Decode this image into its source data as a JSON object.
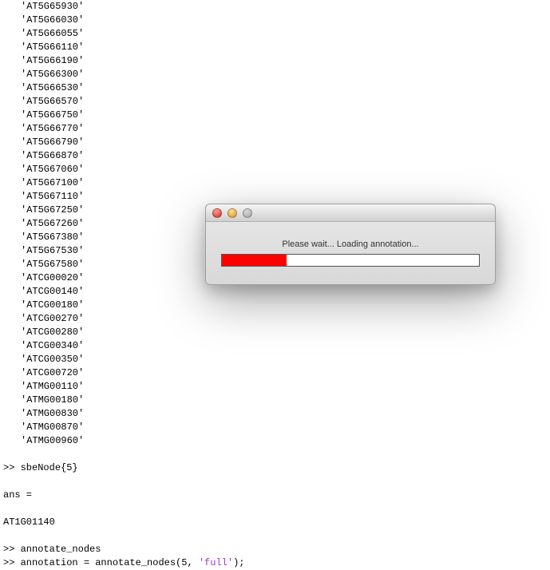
{
  "terminal": {
    "genes": [
      "AT5G65930",
      "AT5G66030",
      "AT5G66055",
      "AT5G66110",
      "AT5G66190",
      "AT5G66300",
      "AT5G66530",
      "AT5G66570",
      "AT5G66750",
      "AT5G66770",
      "AT5G66790",
      "AT5G66870",
      "AT5G67060",
      "AT5G67100",
      "AT5G67110",
      "AT5G67250",
      "AT5G67260",
      "AT5G67380",
      "AT5G67530",
      "AT5G67580",
      "ATCG00020",
      "ATCG00140",
      "ATCG00180",
      "ATCG00270",
      "ATCG00280",
      "ATCG00340",
      "ATCG00350",
      "ATCG00720",
      "ATMG00110",
      "ATMG00180",
      "ATMG00830",
      "ATMG00870",
      "ATMG00960"
    ],
    "cmd1_prompt": ">> ",
    "cmd1_text": "sbeNode{5}",
    "ans_label": "ans =",
    "ans_value": "AT1G01140",
    "cmd2_prompt": ">> ",
    "cmd2_text": "annotate_nodes",
    "cmd3_prompt": ">> ",
    "cmd3_pre": "annotation = annotate_nodes(5, ",
    "cmd3_str": "'full'",
    "cmd3_post": ");"
  },
  "dialog": {
    "message": "Please wait... Loading annotation...",
    "progress_percent": 25
  },
  "colors": {
    "progress_fill": "#ff0000",
    "string_literal": "#9a3bcc"
  }
}
